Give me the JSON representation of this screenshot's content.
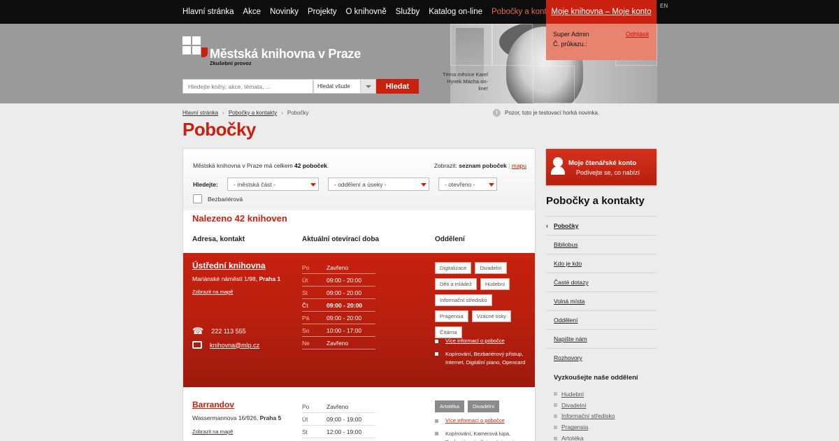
{
  "topnav": {
    "items": [
      "Hlavní stránka",
      "Akce",
      "Novinky",
      "Projekty",
      "O knihovně",
      "Služby",
      "Katalog on-line",
      "Pobočky a kontakty"
    ],
    "active_index": 7,
    "my_library": "Moje knihovna – Moje konto",
    "lang": "EN"
  },
  "header": {
    "logo_title": "Městská knihovna v Praze",
    "logo_subtitle": "Zkušební provoz",
    "theme_text": "Téma měsíce Karel Hynek Mácha on-line!"
  },
  "search": {
    "placeholder": "Hledejte knihy, akce, témata, ...",
    "scope": "Hledat všude",
    "button": "Hledat"
  },
  "user": {
    "name": "Super Admin",
    "card": "Č. průkazu.:",
    "logout": "Odhlásit"
  },
  "breadcrumb": [
    "Hlavní stránka",
    "Pobočky a kontakty",
    "Pobočky"
  ],
  "notice": "Pozor, toto je testovací horká novinka.",
  "page_title": "Pobočky",
  "filters": {
    "count_prefix": "Městská knihovna v Praze má celkem",
    "count_value": "42 poboček",
    "count_suffix": ".",
    "show_label": "Zobrazit:",
    "show_list": "seznam poboček",
    "show_sep": "|",
    "show_map": "mapu",
    "search_label": "Hledejte:",
    "district": "- městská část -",
    "department": "- oddělení a úseky -",
    "open": "- otevřeno -",
    "barrier_free": "Bezbariérová"
  },
  "results": {
    "found": "Nalezeno 42 knihoven",
    "col_address": "Adresa, kontakt",
    "col_hours": "Aktuální otevírací doba",
    "col_departments": "Oddělení"
  },
  "libraries": [
    {
      "name": "Ústřední knihovna",
      "address": "Mariánské náměstí 1/98,",
      "district": "Praha 1",
      "map_link": "Zobrazit na mapě",
      "hours": [
        {
          "day": "Po",
          "time": "Zavřeno"
        },
        {
          "day": "Út",
          "time": "09:00 - 20:00"
        },
        {
          "day": "St",
          "time": "09:00 - 20:00"
        },
        {
          "day": "Čt",
          "time": "09:00 - 20:00"
        },
        {
          "day": "Pá",
          "time": "09:00 - 20:00"
        },
        {
          "day": "So",
          "time": "10:00 - 17:00"
        },
        {
          "day": "Ne",
          "time": "Zavřeno"
        }
      ],
      "today_index": 3,
      "departments": [
        "Digitalizace",
        "Divadelní",
        "Děti a mládež",
        "Hudební",
        "Informační středisko",
        "Pragensia",
        "Vzácné tisky",
        "Čítárna"
      ],
      "more_info": "Více informací o pobočce",
      "services": "Kopírování, Bezbariérový přístup, Internet, Digitální piano, Opencard",
      "phone": "222 113 555",
      "email": "knihovna@mlp.cz"
    },
    {
      "name": "Barrandov",
      "address": "Wassermannova 16/926,",
      "district": "Praha 5",
      "map_link": "Zobrazit na mapě",
      "hours": [
        {
          "day": "Po",
          "time": "Zavřeno"
        },
        {
          "day": "Út",
          "time": "09:00 - 19:00"
        },
        {
          "day": "St",
          "time": "12:00 - 19:00"
        }
      ],
      "departments": [
        "Artotéka",
        "Divadelní"
      ],
      "more_info": "Více informací o pobočce",
      "services": "Kopírování, Kamerová lupa, Bezbariérový přístup, Internet"
    }
  ],
  "sidebar": {
    "account_title": "Moje čtenářské konto",
    "account_sub": "Podívejte se, co nabízí",
    "section_title": "Pobočky a kontakty",
    "items": [
      "Pobočky",
      "Bibliobus",
      "Kdo je kdo",
      "Časté dotazy",
      "Volná místa",
      "Oddělení",
      "Napište nám",
      "Rozhovory"
    ],
    "current_index": 0,
    "try_title": "Vyzkoušejte naše oddělení",
    "departments": [
      "Hudební",
      "Divadelní",
      "Informační středisko",
      "Pragensia",
      "Artotéka"
    ]
  },
  "colors": {
    "accent": "#c8210f",
    "header_bg": "#9a9a9a",
    "nav_bg": "#0d0d0d"
  }
}
